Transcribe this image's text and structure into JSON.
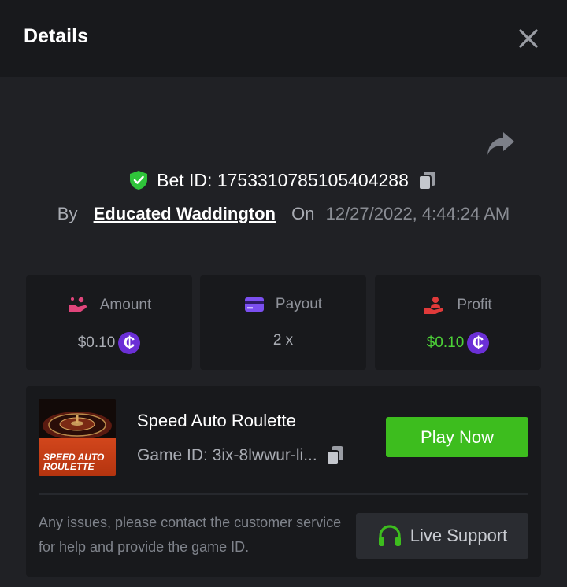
{
  "header": {
    "title": "Details"
  },
  "bet": {
    "id_label": "Bet ID: 1753310785105404288",
    "by_label": "By",
    "user": "Educated Waddington",
    "on_label": "On",
    "datetime": "12/27/2022, 4:44:24 AM"
  },
  "stats": {
    "amount": {
      "label": "Amount",
      "value": "$0.10"
    },
    "payout": {
      "label": "Payout",
      "value": "2 x"
    },
    "profit": {
      "label": "Profit",
      "value": "$0.10"
    }
  },
  "game": {
    "name": "Speed Auto Roulette",
    "id_label": "Game ID: 3ix-8lwwur-li...",
    "thumb_line1": "SPEED AUTO",
    "thumb_line2": "ROULETTE",
    "play_label": "Play Now"
  },
  "support": {
    "help_text": "Any issues, please contact the customer service for help and provide the game ID.",
    "button_label": "Live Support"
  },
  "currency_symbol": "₵",
  "colors": {
    "accent_green": "#3dbd1e",
    "profit_green": "#4cd137",
    "coin_purple": "#6b2fd6",
    "amount_pink": "#e0457b",
    "payout_purple": "#7b4ff0",
    "profit_red": "#e03a3a"
  },
  "icons": {
    "close": "close-icon",
    "share": "share-icon",
    "verified": "shield-check-icon",
    "copy": "copy-icon",
    "amount": "hand-coins-icon",
    "payout": "card-icon",
    "profit": "hand-person-icon",
    "support": "headset-icon"
  }
}
